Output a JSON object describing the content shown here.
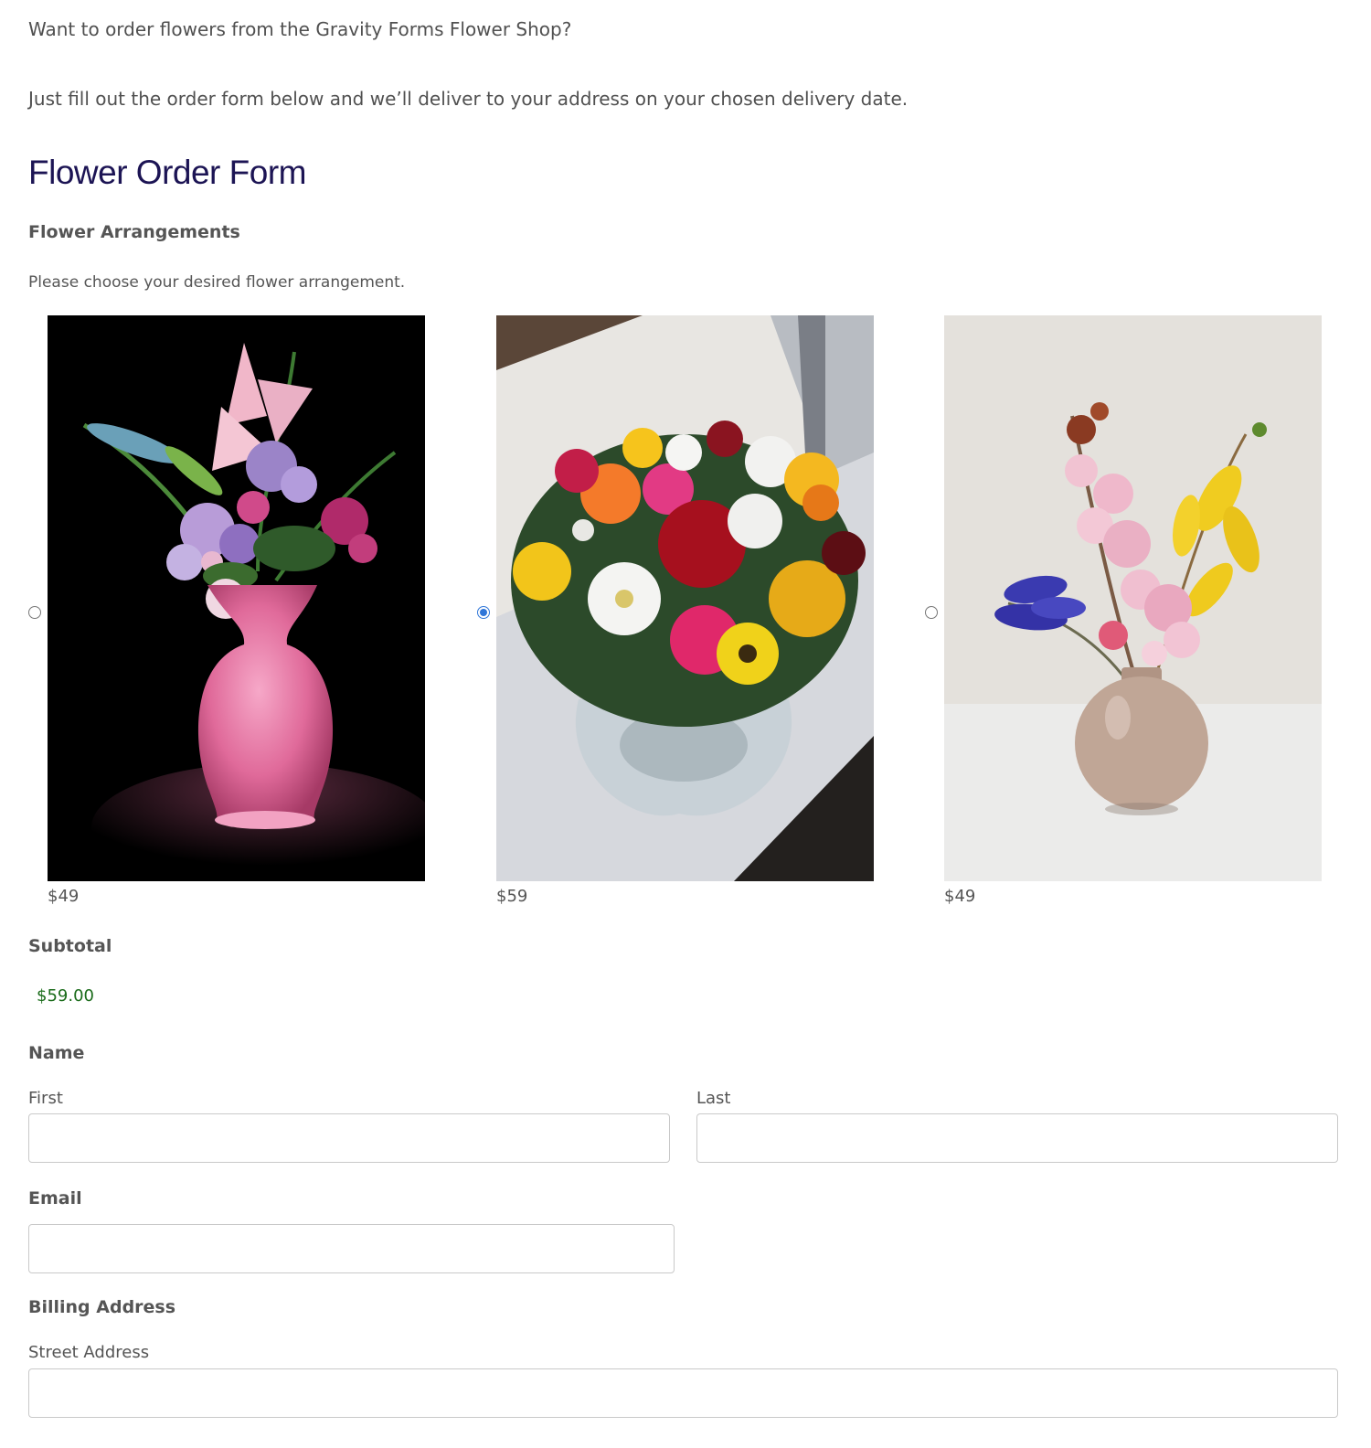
{
  "intro": {
    "line1": "Want to order flowers from the Gravity Forms Flower Shop?",
    "line2": "Just fill out the order form below and we’ll deliver to your address on your chosen delivery date."
  },
  "form": {
    "title": "Flower Order Form",
    "arrangements": {
      "label": "Flower Arrangements",
      "description": "Please choose your desired flower arrangement.",
      "choices": [
        {
          "price": "$49",
          "selected": false,
          "image": "pink-vase-bouquet-image"
        },
        {
          "price": "$59",
          "selected": true,
          "image": "mixed-roses-bouquet-image"
        },
        {
          "price": "$49",
          "selected": false,
          "image": "cherry-blossom-vase-image"
        }
      ]
    },
    "subtotal": {
      "label": "Subtotal",
      "value": "$59.00"
    },
    "name": {
      "label": "Name",
      "first_label": "First",
      "first_value": "",
      "last_label": "Last",
      "last_value": ""
    },
    "email": {
      "label": "Email",
      "value": ""
    },
    "billing": {
      "label": "Billing Address",
      "street_label": "Street Address",
      "street_value": ""
    }
  },
  "colors": {
    "title": "#1c1454",
    "subtotal": "#1a6b1a",
    "radio_selected": "#2f76d8"
  }
}
